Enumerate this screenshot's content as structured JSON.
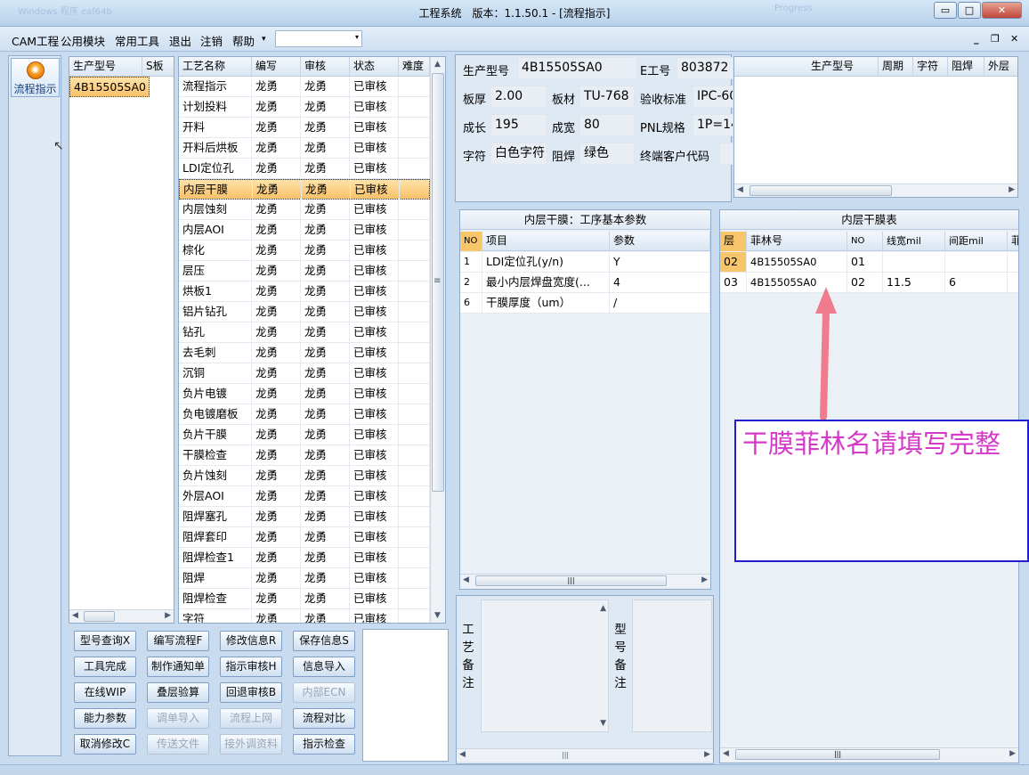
{
  "window": {
    "title": "工程系统　版本：1.1.50.1 - [流程指示]",
    "ghost_left": "Windows 程序 eaf64b",
    "ghost_right": "Progress",
    "btn_min": "▭",
    "btn_max": "□",
    "btn_close": "✕"
  },
  "menu": {
    "items": [
      "CAM工程",
      "公用模块",
      "常用工具",
      "退出",
      "注销",
      "帮助"
    ],
    "help_arrow": "▾",
    "combo_value": "",
    "combo_arrow": "▾",
    "mdi_min": "_",
    "mdi_restore": "❐",
    "mdi_close": "✕"
  },
  "left_nav": {
    "button_label": "流程指示",
    "icon_glyph": "◉"
  },
  "product_list": {
    "headers": [
      "生产型号",
      "S板"
    ],
    "rows": [
      [
        "4B15505SA0",
        ""
      ]
    ]
  },
  "process_list": {
    "headers": [
      "工艺名称",
      "编写",
      "审核",
      "状态",
      "难度"
    ],
    "rows": [
      [
        "流程指示",
        "龙勇",
        "龙勇",
        "已审核",
        ""
      ],
      [
        "计划投料",
        "龙勇",
        "龙勇",
        "已审核",
        ""
      ],
      [
        "开料",
        "龙勇",
        "龙勇",
        "已审核",
        ""
      ],
      [
        "开料后烘板",
        "龙勇",
        "龙勇",
        "已审核",
        ""
      ],
      [
        "LDI定位孔",
        "龙勇",
        "龙勇",
        "已审核",
        ""
      ],
      [
        "内层干膜",
        "龙勇",
        "龙勇",
        "已审核",
        ""
      ],
      [
        "内层蚀刻",
        "龙勇",
        "龙勇",
        "已审核",
        ""
      ],
      [
        "内层AOI",
        "龙勇",
        "龙勇",
        "已审核",
        ""
      ],
      [
        "棕化",
        "龙勇",
        "龙勇",
        "已审核",
        ""
      ],
      [
        "层压",
        "龙勇",
        "龙勇",
        "已审核",
        ""
      ],
      [
        "烘板1",
        "龙勇",
        "龙勇",
        "已审核",
        ""
      ],
      [
        "铝片钻孔",
        "龙勇",
        "龙勇",
        "已审核",
        ""
      ],
      [
        "钻孔",
        "龙勇",
        "龙勇",
        "已审核",
        ""
      ],
      [
        "去毛刺",
        "龙勇",
        "龙勇",
        "已审核",
        ""
      ],
      [
        "沉铜",
        "龙勇",
        "龙勇",
        "已审核",
        ""
      ],
      [
        "负片电镀",
        "龙勇",
        "龙勇",
        "已审核",
        ""
      ],
      [
        "负电镀磨板",
        "龙勇",
        "龙勇",
        "已审核",
        ""
      ],
      [
        "负片干膜",
        "龙勇",
        "龙勇",
        "已审核",
        ""
      ],
      [
        "干膜检查",
        "龙勇",
        "龙勇",
        "已审核",
        ""
      ],
      [
        "负片蚀刻",
        "龙勇",
        "龙勇",
        "已审核",
        ""
      ],
      [
        "外层AOI",
        "龙勇",
        "龙勇",
        "已审核",
        ""
      ],
      [
        "阻焊塞孔",
        "龙勇",
        "龙勇",
        "已审核",
        ""
      ],
      [
        "阻焊套印",
        "龙勇",
        "龙勇",
        "已审核",
        ""
      ],
      [
        "阻焊检查1",
        "龙勇",
        "龙勇",
        "已审核",
        ""
      ],
      [
        "阻焊",
        "龙勇",
        "龙勇",
        "已审核",
        ""
      ],
      [
        "阻焊检查",
        "龙勇",
        "龙勇",
        "已审核",
        ""
      ],
      [
        "字符",
        "龙勇",
        "龙勇",
        "已审核",
        ""
      ]
    ],
    "selected_index": 5
  },
  "actions": [
    [
      {
        "label": "型号查询X",
        "enabled": true
      },
      {
        "label": "编写流程F",
        "enabled": true
      },
      {
        "label": "修改信息R",
        "enabled": true
      },
      {
        "label": "保存信息S",
        "enabled": true
      }
    ],
    [
      {
        "label": "工具完成",
        "enabled": true
      },
      {
        "label": "制作通知单",
        "enabled": true
      },
      {
        "label": "指示审核H",
        "enabled": true
      },
      {
        "label": "信息导入",
        "enabled": true
      }
    ],
    [
      {
        "label": "在线WIP",
        "enabled": true
      },
      {
        "label": "叠层验算",
        "enabled": true
      },
      {
        "label": "回退审核B",
        "enabled": true
      },
      {
        "label": "内部ECN",
        "enabled": false
      }
    ],
    [
      {
        "label": "能力参数",
        "enabled": true
      },
      {
        "label": "调单导入",
        "enabled": false
      },
      {
        "label": "流程上网",
        "enabled": false
      },
      {
        "label": "流程对比",
        "enabled": true
      }
    ],
    [
      {
        "label": "取消修改C",
        "enabled": true
      },
      {
        "label": "传送文件",
        "enabled": false
      },
      {
        "label": "接外调资料",
        "enabled": false
      },
      {
        "label": "指示检查",
        "enabled": true
      }
    ]
  ],
  "info": {
    "prod_model_label": "生产型号",
    "prod_model_value": "4B15505SA0",
    "e_no_label": "E工号",
    "e_no_value": "803872",
    "thickness_label": "板厚",
    "thickness_value": "2.00",
    "material_label": "板材",
    "material_value": "TU-768",
    "standard_label": "验收标准",
    "standard_value": "IPC-60",
    "length_label": "成长",
    "length_value": "195",
    "width_label": "成宽",
    "width_value": "80",
    "pnl_label": "PNL规格",
    "pnl_value": "1P=14",
    "char_label": "字符",
    "char_value": "白色字符",
    "mask_label": "阻焊",
    "mask_value": "绿色",
    "customer_label": "终端客户代码",
    "customer_value": ""
  },
  "history_grid": {
    "headers": [
      "生产型号",
      "周期",
      "字符",
      "阻焊",
      "外层"
    ]
  },
  "params": {
    "caption": "内层干膜：工序基本参数",
    "headers": [
      "NO",
      "项目",
      "参数"
    ],
    "rows": [
      [
        "1",
        "LDI定位孔(y/n)",
        "Y"
      ],
      [
        "2",
        "最小内层焊盘宽度(...",
        "4"
      ],
      [
        "6",
        "干膜厚度（um）",
        "/"
      ]
    ]
  },
  "film_table": {
    "caption": "内层干膜表",
    "headers": [
      "层",
      "菲林号",
      "NO",
      "线宽mil",
      "间距mil",
      "菲"
    ],
    "rows": [
      [
        "02",
        "4B15505SA0",
        "01",
        "",
        ""
      ],
      [
        "03",
        "4B15505SA0",
        "02",
        "11.5",
        "6"
      ]
    ]
  },
  "remarks": {
    "process_label": [
      "工",
      "艺",
      "备",
      "注"
    ],
    "model_label": [
      "型",
      "号",
      "备",
      "注"
    ]
  },
  "scroll": {
    "up": "▲",
    "down": "▼",
    "left": "◀",
    "right": "▶",
    "grip": "|||",
    "vgrip": "≡"
  },
  "annotation": {
    "text": "干膜菲林名请填写完整",
    "arrow_color": "#f07b8c",
    "border_color": "#1f1fcf",
    "text_color": "#d639c8"
  }
}
